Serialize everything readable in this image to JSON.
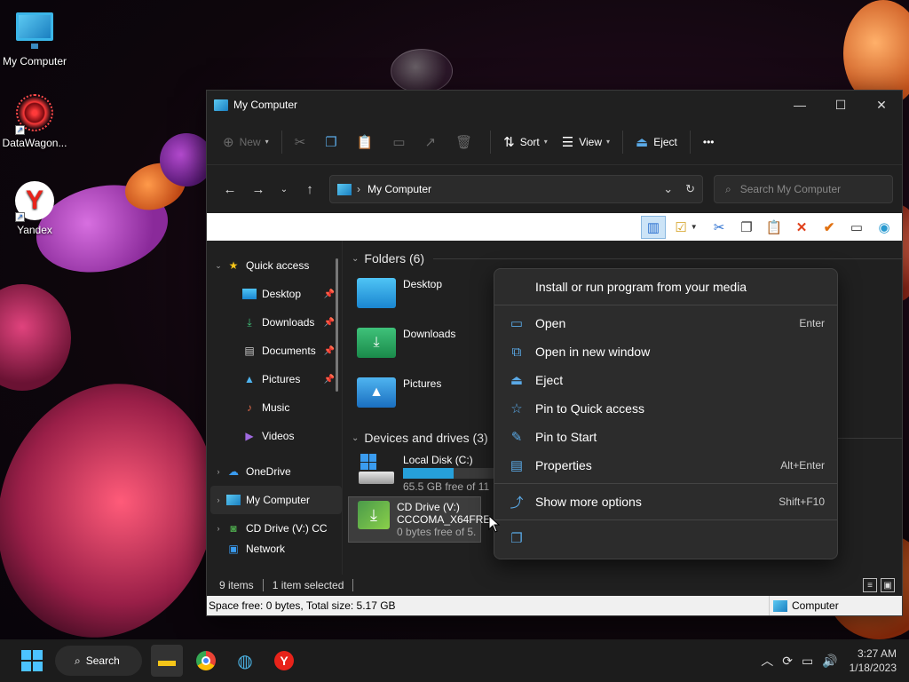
{
  "desktop": {
    "icons": [
      {
        "label": "My Computer",
        "icon": "computer-icon"
      },
      {
        "label": "DataWagon...",
        "icon": "datawagon-icon"
      },
      {
        "label": "Yandex",
        "icon": "yandex-icon",
        "glyph": "Y"
      }
    ]
  },
  "window": {
    "title": "My Computer",
    "controls": {
      "minimize": "—",
      "maximize": "☐",
      "close": "✕"
    },
    "toolbar": {
      "new_label": "New",
      "sort_label": "Sort",
      "view_label": "View",
      "eject_label": "Eject",
      "more": "•••"
    },
    "address": {
      "path": "My Computer",
      "search_placeholder": "Search My Computer"
    },
    "nav": {
      "quick_access": "Quick access",
      "items": [
        {
          "label": "Desktop",
          "icon": "desktop-folder-icon",
          "pinned": true
        },
        {
          "label": "Downloads",
          "icon": "downloads-folder-icon",
          "pinned": true
        },
        {
          "label": "Documents",
          "icon": "documents-folder-icon",
          "pinned": true
        },
        {
          "label": "Pictures",
          "icon": "pictures-folder-icon",
          "pinned": true
        },
        {
          "label": "Music",
          "icon": "music-folder-icon",
          "pinned": false
        },
        {
          "label": "Videos",
          "icon": "videos-folder-icon",
          "pinned": false
        }
      ],
      "onedrive": "OneDrive",
      "my_computer": "My Computer",
      "cd_drive": "CD Drive (V:) CC",
      "network": "Network"
    },
    "content": {
      "folders_header": "Folders (6)",
      "folders": [
        {
          "label": "Desktop",
          "icon": "desktop-folder-icon"
        },
        {
          "label": "Downloads",
          "icon": "downloads-folder-icon"
        },
        {
          "label": "Pictures",
          "icon": "pictures-folder-icon"
        }
      ],
      "drives_header": "Devices and drives (3)",
      "drives": [
        {
          "name": "Local Disk (C:)",
          "free": "65.5 GB free of 11",
          "usage": 0.52
        },
        {
          "name": "CD Drive (V:)",
          "name2": "CCCOMA_X64FRE",
          "free": "0 bytes free of 5."
        }
      ]
    },
    "status": {
      "items": "9 items",
      "selected": "1 item selected"
    },
    "legacy_status": {
      "space": "Space free: 0 bytes, Total size: 5.17 GB",
      "location": "Computer"
    }
  },
  "context_menu": {
    "header": "Install or run program from your media",
    "items": [
      {
        "label": "Open",
        "shortcut": "Enter",
        "icon": "open-icon"
      },
      {
        "label": "Open in new window",
        "shortcut": "",
        "icon": "open-new-window-icon"
      },
      {
        "label": "Eject",
        "shortcut": "",
        "icon": "eject-icon"
      },
      {
        "label": "Pin to Quick access",
        "shortcut": "",
        "icon": "star-icon"
      },
      {
        "label": "Pin to Start",
        "shortcut": "",
        "icon": "pin-icon"
      },
      {
        "label": "Properties",
        "shortcut": "Alt+Enter",
        "icon": "properties-icon"
      }
    ],
    "more": {
      "label": "Show more options",
      "shortcut": "Shift+F10"
    }
  },
  "taskbar": {
    "search_label": "Search",
    "time": "3:27 AM",
    "date": "1/18/2023"
  }
}
